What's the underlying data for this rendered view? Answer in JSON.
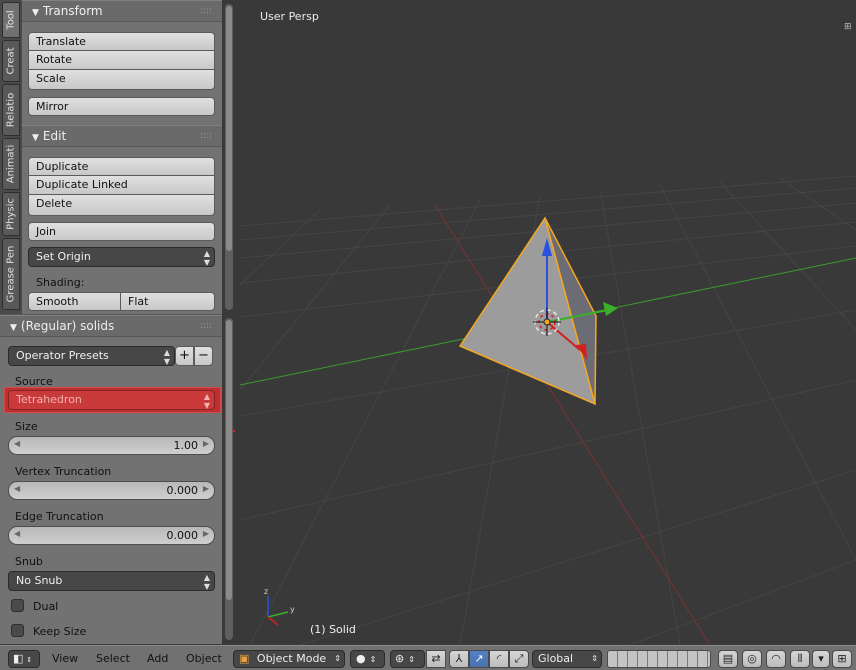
{
  "tabs": [
    "Tool",
    "Creat",
    "Relatio",
    "Animati",
    "Physic",
    "Grease Pen"
  ],
  "transform_panel": {
    "title": "Transform",
    "buttons": [
      "Translate",
      "Rotate",
      "Scale"
    ],
    "mirror": "Mirror"
  },
  "edit_panel": {
    "title": "Edit",
    "buttons": [
      "Duplicate",
      "Duplicate Linked",
      "Delete"
    ],
    "join": "Join",
    "set_origin": "Set Origin",
    "shading_label": "Shading:",
    "smooth": "Smooth",
    "flat": "Flat"
  },
  "operator": {
    "title": "(Regular) solids",
    "presets": "Operator Presets",
    "add_symbol": "+",
    "remove_symbol": "−",
    "source_label": "Source",
    "source_value": "Tetrahedron",
    "annotation": "1",
    "size_label": "Size",
    "size_value": "1.00",
    "vertex_label": "Vertex Truncation",
    "vertex_value": "0.000",
    "edge_label": "Edge Truncation",
    "edge_value": "0.000",
    "snub_label": "Snub",
    "snub_value": "No Snub",
    "dual_label": "Dual",
    "keep_size_label": "Keep Size"
  },
  "viewport": {
    "title": "User Persp",
    "status": "(1) Solid"
  },
  "header": {
    "menus": [
      "View",
      "Select",
      "Add",
      "Object"
    ],
    "mode": "Object Mode",
    "orientation": "Global"
  },
  "colors": {
    "highlight": "#c93a3a",
    "selection_outline": "#f5a623",
    "x_axis": "#8a3030",
    "y_axis": "#3c9a2e"
  }
}
